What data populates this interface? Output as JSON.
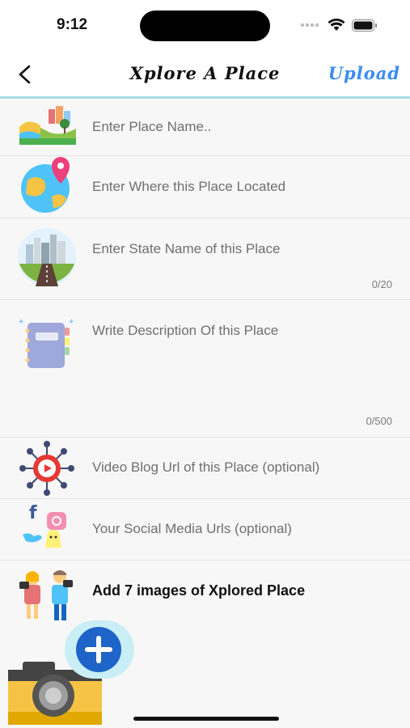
{
  "status_bar": {
    "time": "9:12"
  },
  "nav": {
    "title": "Xplore A Place",
    "upload_label": "Upload"
  },
  "form": {
    "place_name": {
      "placeholder": "Enter Place Name..",
      "icon": "landscape-icon"
    },
    "location": {
      "placeholder": "Enter Where this Place Located",
      "icon": "globe-pin-icon"
    },
    "state": {
      "placeholder": "Enter State Name of this Place",
      "counter": "0/20",
      "icon": "city-road-icon"
    },
    "description": {
      "placeholder": "Write Description Of this Place",
      "counter": "0/500",
      "icon": "notebook-icon"
    },
    "video_blog": {
      "placeholder": "Video Blog Url of this Place (optional)",
      "icon": "video-network-icon"
    },
    "social": {
      "placeholder": "Your Social Media Urls (optional)",
      "icon": "social-media-icon"
    },
    "images": {
      "label": "Add 7 images of Xplored Place",
      "icon": "travelers-icon"
    }
  },
  "add_image_button": {
    "icon": "plus-icon"
  },
  "colors": {
    "accent": "#3b8cf0",
    "divider": "#a8dde3",
    "background": "#f7f7f7"
  }
}
